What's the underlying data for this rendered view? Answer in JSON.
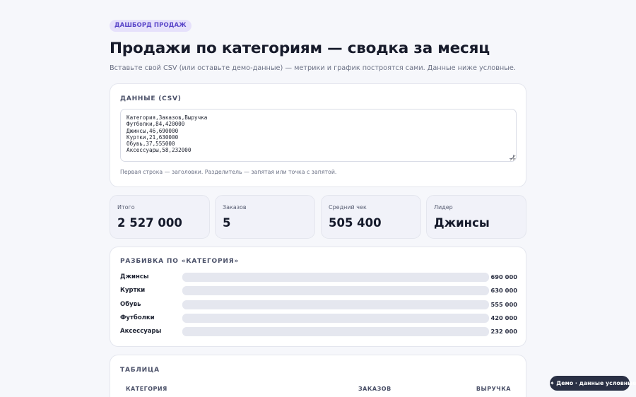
{
  "badge": "ДАШБОРД ПРОДАЖ",
  "title": "Продажи по категориям — сводка за месяц",
  "subtitle": "Вставьте свой CSV (или оставьте демо-данные) — метрики и график построятся сами. Данные ниже условные.",
  "csv": {
    "label": "ДАННЫЕ (CSV)",
    "lines": [
      "Категория,Заказов,Выручка",
      "Футболки,84,420000",
      "Джинсы,46,690000",
      "Куртки,21,630000",
      "Обувь,37,555000",
      "Аксессуары,58,232000"
    ],
    "hint": "Первая строка — заголовки. Разделитель — запятая или точка с запятой."
  },
  "stats": [
    {
      "label": "Итого",
      "value": "2 527 000"
    },
    {
      "label": "Заказов",
      "value": "5"
    },
    {
      "label": "Средний чек",
      "value": "505 400"
    },
    {
      "label": "Лидер",
      "value": "Джинсы"
    }
  ],
  "breakdown": {
    "label": "РАЗБИВКА ПО «КАТЕГОРИЯ»",
    "rows": [
      {
        "name": "Джинсы",
        "value": "690 000",
        "amount": 690000
      },
      {
        "name": "Куртки",
        "value": "630 000",
        "amount": 630000
      },
      {
        "name": "Обувь",
        "value": "555 000",
        "amount": 555000
      },
      {
        "name": "Футболки",
        "value": "420 000",
        "amount": 420000
      },
      {
        "name": "Аксессуары",
        "value": "232 000",
        "amount": 232000
      }
    ]
  },
  "table": {
    "label": "ТАБЛИЦА",
    "columns": [
      "КАТЕГОРИЯ",
      "ЗАКАЗОВ",
      "ВЫРУЧКА"
    ]
  },
  "demo_button": "✦ Демо · данные условные",
  "colors": {
    "accent": "#5b47c9",
    "badge_bg": "#e6e1fb",
    "bar_track": "#e5e7ef",
    "pill_bg": "#2a3045"
  }
}
